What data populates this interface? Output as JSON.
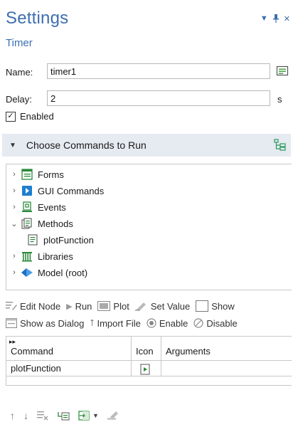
{
  "header": {
    "title": "Settings",
    "subtitle": "Timer"
  },
  "form": {
    "name_label": "Name:",
    "name_value": "timer1",
    "delay_label": "Delay:",
    "delay_value": "2",
    "delay_unit": "s",
    "enabled_label": "Enabled",
    "enabled_checked": true
  },
  "section": {
    "title": "Choose Commands to Run"
  },
  "tree": {
    "items": [
      {
        "label": "Forms",
        "expanded": false,
        "icon": "forms-icon"
      },
      {
        "label": "GUI Commands",
        "expanded": false,
        "icon": "gui-commands-icon"
      },
      {
        "label": "Events",
        "expanded": false,
        "icon": "events-icon"
      },
      {
        "label": "Methods",
        "expanded": true,
        "icon": "methods-icon"
      },
      {
        "label": "plotFunction",
        "child": true,
        "icon": "method-file-icon"
      },
      {
        "label": "Libraries",
        "expanded": false,
        "icon": "libraries-icon"
      },
      {
        "label": "Model (root)",
        "expanded": false,
        "icon": "model-icon"
      }
    ]
  },
  "toolbar": {
    "edit_node": "Edit Node",
    "run": "Run",
    "plot": "Plot",
    "set_value": "Set Value",
    "show": "Show",
    "show_as_dialog": "Show as Dialog",
    "import_file": "Import File",
    "enable": "Enable",
    "disable": "Disable"
  },
  "table": {
    "columns": [
      "Command",
      "Icon",
      "Arguments"
    ],
    "rows": [
      {
        "command": "plotFunction",
        "icon": "method-icon",
        "arguments": ""
      }
    ]
  },
  "colors": {
    "accent": "#3c6fb0",
    "section_bg": "#e6eaf1",
    "border": "#c8c8c8"
  }
}
